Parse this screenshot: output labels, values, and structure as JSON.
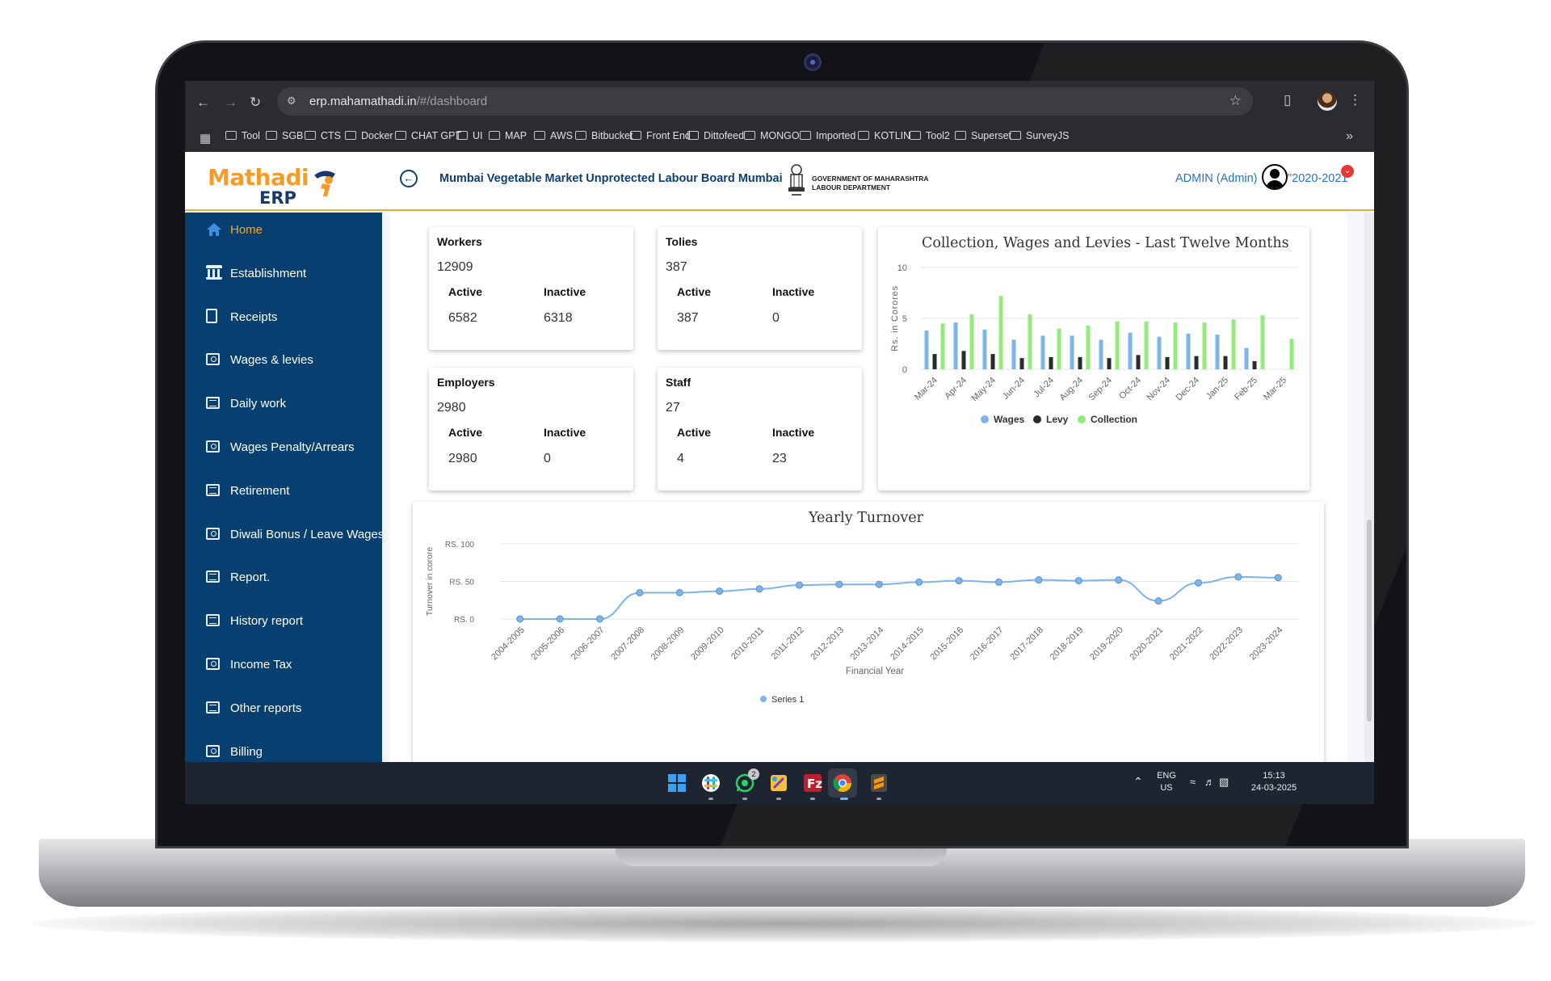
{
  "browser": {
    "url_host": "erp.mahamathadi.in",
    "url_path": "/#/dashboard",
    "bookmarks": [
      "Tool",
      "SGB",
      "CTS",
      "Docker",
      "CHAT GPT",
      "UI",
      "MAP",
      "AWS",
      "Bitbucket",
      "Front End",
      "Dittofeed",
      "MONGO",
      "Imported",
      "KOTLIN",
      "Tool2",
      "Superset",
      "SurveyJS"
    ]
  },
  "header": {
    "logo_main": "Mathadi",
    "logo_sub": "ERP",
    "board_title": "Mumbai Vegetable Market Unprotected Labour Board Mumbai",
    "gov_line1": "GOVERNMENT OF MAHARASHTRA",
    "gov_line2": "LABOUR DEPARTMENT",
    "admin_label": "ADMIN (Admin)",
    "year_label": "\"2020-2021"
  },
  "sidebar": {
    "items": [
      {
        "label": "Home",
        "icon": "home-icon"
      },
      {
        "label": "Establishment",
        "icon": "bank-icon"
      },
      {
        "label": "Receipts",
        "icon": "receipt-icon"
      },
      {
        "label": "Wages & levies",
        "icon": "money-icon"
      },
      {
        "label": "Daily work",
        "icon": "list-icon"
      },
      {
        "label": "Wages Penalty/Arrears",
        "icon": "money-icon"
      },
      {
        "label": "Retirement",
        "icon": "list-icon"
      },
      {
        "label": "Diwali Bonus / Leave Wages",
        "icon": "money-icon"
      },
      {
        "label": "Report.",
        "icon": "list-icon"
      },
      {
        "label": "History report",
        "icon": "list-icon"
      },
      {
        "label": "Income Tax",
        "icon": "money-icon"
      },
      {
        "label": "Other reports",
        "icon": "list-icon"
      },
      {
        "label": "Billing",
        "icon": "money-icon"
      }
    ]
  },
  "stats": {
    "workers": {
      "title": "Workers",
      "total": "12909",
      "active_label": "Active",
      "inactive_label": "Inactive",
      "active": "6582",
      "inactive": "6318"
    },
    "tolies": {
      "title": "Tolies",
      "total": "387",
      "active_label": "Active",
      "inactive_label": "Inactive",
      "active": "387",
      "inactive": "0"
    },
    "employers": {
      "title": "Employers",
      "total": "2980",
      "active_label": "Active",
      "inactive_label": "Inactive",
      "active": "2980",
      "inactive": "0"
    },
    "staff": {
      "title": "Staff",
      "total": "27",
      "active_label": "Active",
      "inactive_label": "Inactive",
      "active": "4",
      "inactive": "23"
    }
  },
  "chart_data": [
    {
      "type": "bar",
      "title": "Collection, Wages and Levies - Last Twelve Months",
      "ylabel": "Rs. in Corores",
      "xlabel": "",
      "ylim": [
        0,
        10
      ],
      "yticks": [
        "0",
        "5",
        "10"
      ],
      "grid": true,
      "legend": "bottom",
      "categories": [
        "Mar-24",
        "Apr-24",
        "May-24",
        "Jun-24",
        "Jul-24",
        "Aug-24",
        "Sep-24",
        "Oct-24",
        "Nov-24",
        "Dec-24",
        "Jan-25",
        "Feb-25",
        "Mar-25"
      ],
      "series": [
        {
          "name": "Wages",
          "color": "#7cb5ec",
          "values": [
            3.8,
            4.6,
            3.9,
            2.9,
            3.3,
            3.3,
            2.9,
            3.6,
            3.2,
            3.5,
            3.4,
            2.1,
            0
          ]
        },
        {
          "name": "Levy",
          "color": "#2b2b2b",
          "values": [
            1.5,
            1.8,
            1.5,
            1.1,
            1.2,
            1.2,
            1.1,
            1.4,
            1.2,
            1.3,
            1.3,
            0.8,
            0
          ]
        },
        {
          "name": "Collection",
          "color": "#90ed7d",
          "values": [
            4.5,
            5.4,
            7.2,
            5.4,
            4.0,
            4.3,
            4.7,
            4.7,
            4.6,
            4.6,
            4.9,
            5.3,
            3.0
          ]
        }
      ]
    },
    {
      "type": "line",
      "title": "Yearly Turnover",
      "ylabel": "Turnover in corore",
      "xlabel": "Financial Year",
      "ylim": [
        0,
        100
      ],
      "yticks": [
        "RS. 0",
        "RS. 50",
        "RS. 100"
      ],
      "grid": true,
      "legend": "bottom",
      "categories": [
        "2004-2005",
        "2005-2006",
        "2006-2007",
        "2007-2008",
        "2008-2009",
        "2009-2010",
        "2010-2011",
        "2011-2012",
        "2012-2013",
        "2013-2014",
        "2014-2015",
        "2015-2016",
        "2016-2017",
        "2017-2018",
        "2018-2019",
        "2019-2020",
        "2020-2021",
        "2021-2022",
        "2022-2023",
        "2023-2024"
      ],
      "series": [
        {
          "name": "Series 1",
          "color": "#7cb5ec",
          "values": [
            0,
            0,
            0,
            35,
            35,
            37,
            40,
            45,
            46,
            46,
            49,
            51,
            49,
            52,
            51,
            52,
            24,
            48,
            56,
            55
          ]
        }
      ]
    }
  ],
  "taskbar": {
    "lang_line1": "ENG",
    "lang_line2": "US",
    "time": "15:13",
    "date": "24-03-2025",
    "whatsapp_badge": "2"
  }
}
